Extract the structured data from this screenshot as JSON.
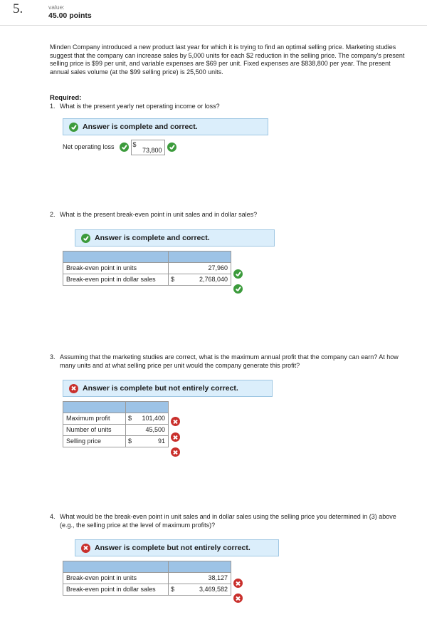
{
  "header": {
    "question_number": "5.",
    "value_label": "value:",
    "points": "45.00 points"
  },
  "problem": {
    "text": "Minden Company introduced a new product last year for which it is trying to find an optimal selling price. Marketing studies suggest that the company can increase sales by 5,000 units for each $2 reduction in the selling price. The company's present selling price is $99 per unit, and variable expenses are $69 per unit. Fixed expenses are $838,800 per year. The present annual sales volume (at the $99 selling price) is 25,500 units.",
    "required_label": "Required:"
  },
  "questions": [
    {
      "number": "1.",
      "text": "What is the present yearly net operating income or loss?",
      "banner": "Answer is complete and correct.",
      "banner_status": "correct",
      "field_label": "Net operating loss",
      "field_dollar": "$",
      "field_value": "73,800"
    },
    {
      "number": "2.",
      "text": "What is the present break-even point in unit sales and in dollar sales?",
      "banner": "Answer is complete and correct.",
      "banner_status": "correct",
      "rows": [
        {
          "label": "Break-even point in units",
          "dollar": "",
          "value": "27,960",
          "status": "correct"
        },
        {
          "label": "Break-even point in dollar sales",
          "dollar": "$",
          "value": "2,768,040",
          "status": "correct"
        }
      ]
    },
    {
      "number": "3.",
      "text": "Assuming that the marketing studies are correct, what is the maximum annual profit that the company can earn? At how many units and at what selling price per unit would the company generate this profit?",
      "banner": "Answer is complete but not entirely correct.",
      "banner_status": "incorrect",
      "rows": [
        {
          "label": "Maximum profit",
          "dollar": "$",
          "value": "101,400",
          "status": "incorrect"
        },
        {
          "label": "Number of units",
          "dollar": "",
          "value": "45,500",
          "status": "incorrect"
        },
        {
          "label": "Selling price",
          "dollar": "$",
          "value": "91",
          "status": "incorrect"
        }
      ]
    },
    {
      "number": "4.",
      "text": "What would be the break-even point in unit sales and in dollar sales using the selling price you determined in (3) above (e.g., the selling price at the level of maximum profits)?",
      "banner": "Answer is complete but not entirely correct.",
      "banner_status": "incorrect",
      "rows": [
        {
          "label": "Break-even point in units",
          "dollar": "",
          "value": "38,127",
          "status": "incorrect"
        },
        {
          "label": "Break-even point in dollar sales",
          "dollar": "$",
          "value": "3,469,582",
          "status": "incorrect"
        }
      ]
    }
  ],
  "colors": {
    "banner_bg": "#dbeefb",
    "banner_border": "#9fc7e3",
    "table_header": "#9dc3e6",
    "correct": "#3c9b3c",
    "incorrect": "#c9302c"
  }
}
